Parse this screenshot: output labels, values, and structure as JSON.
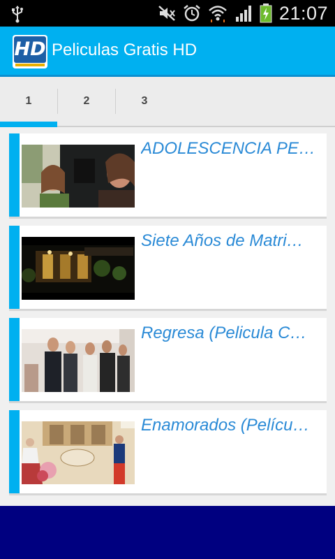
{
  "status_bar": {
    "time": "21:07",
    "icons": [
      "usb-icon",
      "mute-icon",
      "alarm-icon",
      "wifi-icon",
      "signal-icon",
      "battery-charging-icon"
    ]
  },
  "action_bar": {
    "app_icon_text": "HD",
    "title": "Peliculas Gratis HD",
    "background_color": "#00b0f0"
  },
  "tabs": [
    {
      "label": "1",
      "selected": true
    },
    {
      "label": "2",
      "selected": false
    },
    {
      "label": "3",
      "selected": false
    }
  ],
  "movies": [
    {
      "title": "ADOLESCENCIA PE…",
      "thumb": "two people in car"
    },
    {
      "title": "Siete Años de Matri…",
      "thumb": "night restaurant facade"
    },
    {
      "title": "Regresa (Pelicula C…",
      "thumb": "group of people in office"
    },
    {
      "title": "Enamorados (Pelícu…",
      "thumb": "illustrated poster with couple"
    }
  ],
  "colors": {
    "accent": "#00b0f0",
    "title_text": "#2a8ad6",
    "footer": "#000080"
  }
}
